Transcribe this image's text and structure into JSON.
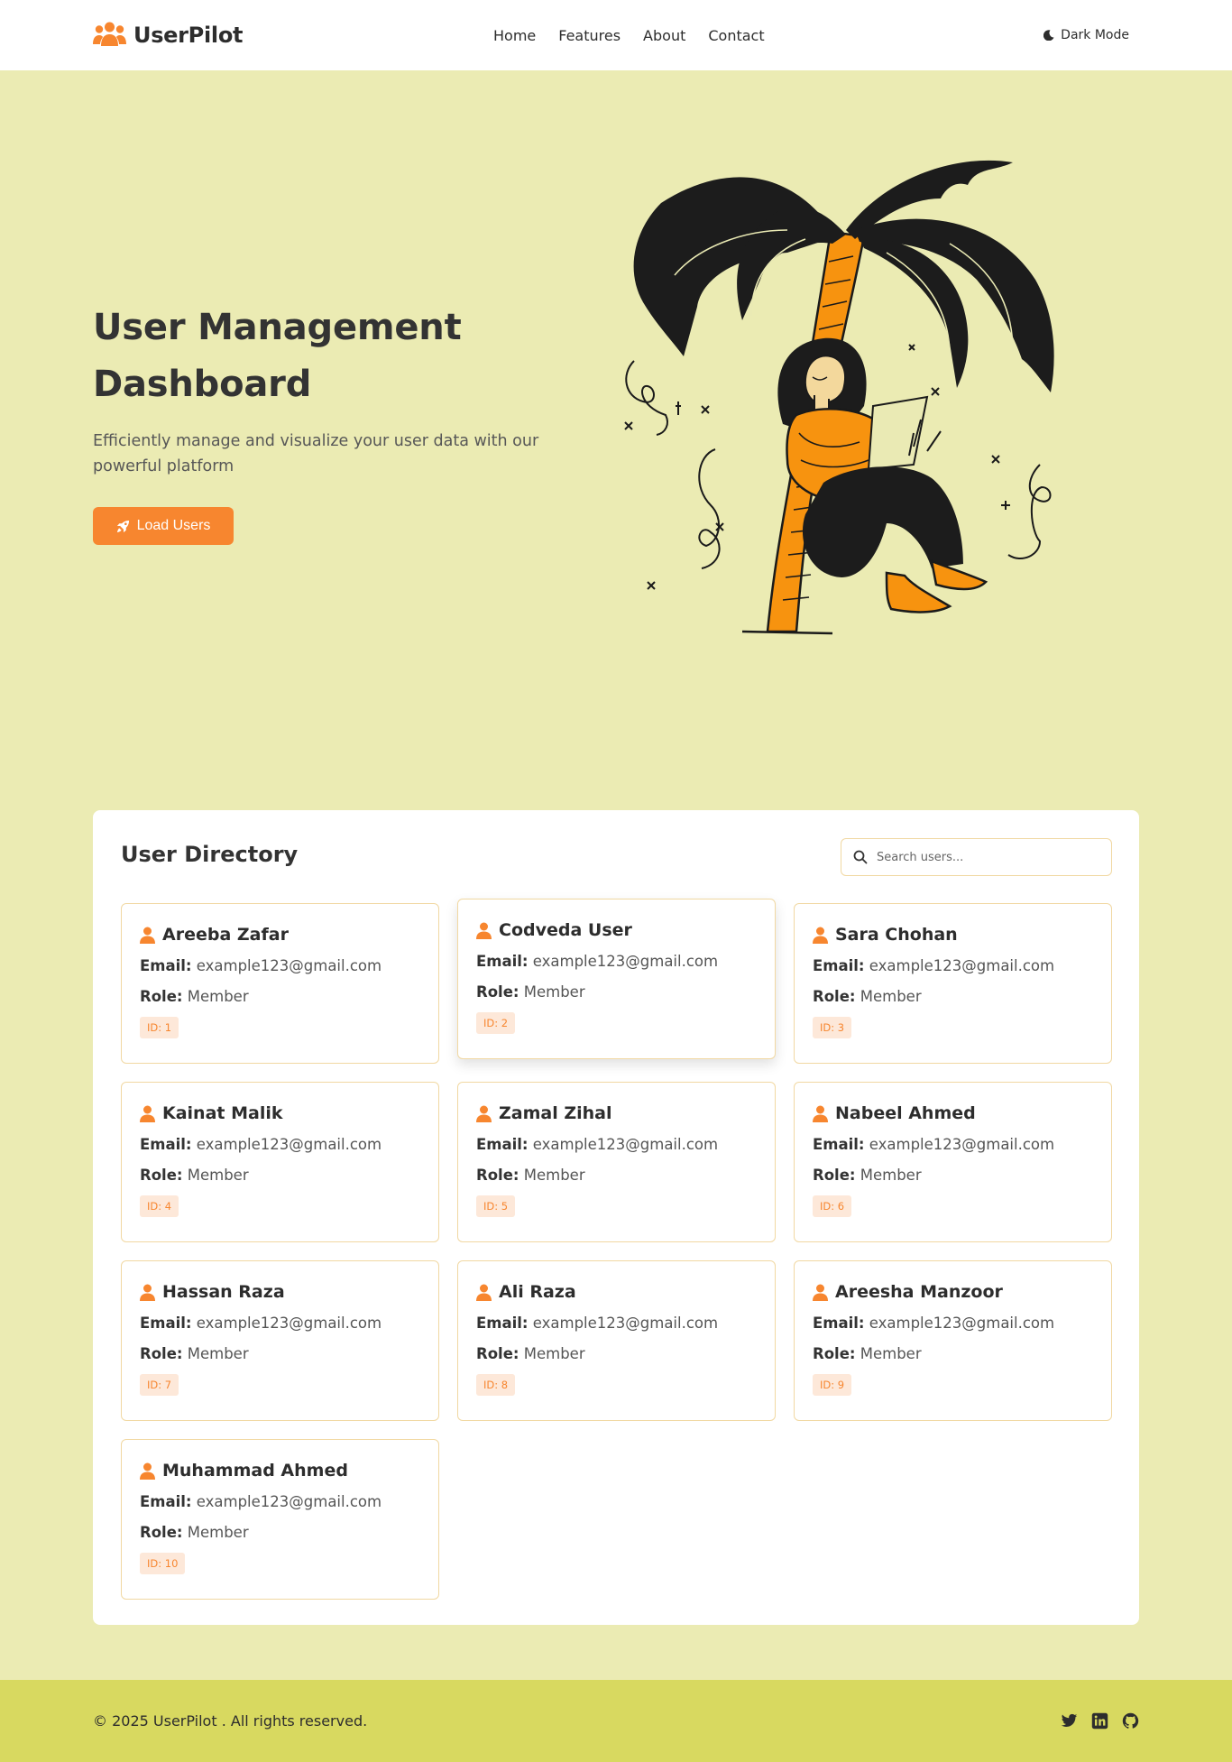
{
  "colors": {
    "accent": "#f7862f",
    "page_bg": "#ebebb3",
    "footer_bg": "#d8d960",
    "card_border": "#f1d8a2",
    "badge_bg": "#fde8d9"
  },
  "navbar": {
    "brand": "UserPilot",
    "brand_icon": "users-icon",
    "links": [
      "Home",
      "Features",
      "About",
      "Contact"
    ],
    "theme_toggle": {
      "icon": "moon-icon",
      "label": "Dark Mode"
    }
  },
  "hero": {
    "title": "User Management Dashboard",
    "subtitle": "Efficiently manage and visualize your user data with our powerful platform",
    "button": {
      "icon": "rocket-icon",
      "label": "Load Users"
    }
  },
  "directory": {
    "title": "User Directory",
    "search": {
      "icon": "search-icon",
      "placeholder": "Search users...",
      "value": ""
    },
    "email_label": "Email:",
    "role_label": "Role:",
    "users": [
      {
        "name": "Areeba Zafar",
        "email": "example123@gmail.com",
        "role": "Member",
        "id": "ID: 1"
      },
      {
        "name": "Codveda User",
        "email": "example123@gmail.com",
        "role": "Member",
        "id": "ID: 2"
      },
      {
        "name": "Sara Chohan",
        "email": "example123@gmail.com",
        "role": "Member",
        "id": "ID: 3"
      },
      {
        "name": "Kainat Malik",
        "email": "example123@gmail.com",
        "role": "Member",
        "id": "ID: 4"
      },
      {
        "name": "Zamal Zihal",
        "email": "example123@gmail.com",
        "role": "Member",
        "id": "ID: 5"
      },
      {
        "name": "Nabeel Ahmed",
        "email": "example123@gmail.com",
        "role": "Member",
        "id": "ID: 6"
      },
      {
        "name": "Hassan Raza",
        "email": "example123@gmail.com",
        "role": "Member",
        "id": "ID: 7"
      },
      {
        "name": "Ali Raza",
        "email": "example123@gmail.com",
        "role": "Member",
        "id": "ID: 8"
      },
      {
        "name": "Areesha Manzoor",
        "email": "example123@gmail.com",
        "role": "Member",
        "id": "ID: 9"
      },
      {
        "name": "Muhammad Ahmed",
        "email": "example123@gmail.com",
        "role": "Member",
        "id": "ID: 10"
      }
    ]
  },
  "footer": {
    "copyright": "© 2025 UserPilot . All rights reserved.",
    "socials": [
      "twitter-icon",
      "linkedin-icon",
      "github-icon"
    ]
  }
}
